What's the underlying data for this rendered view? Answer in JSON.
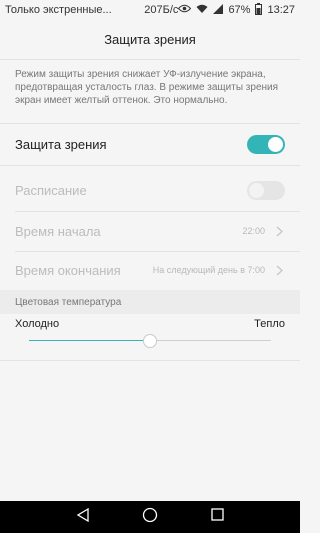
{
  "status_bar": {
    "carrier": "Только экстренные...",
    "net_speed": "207Б/с",
    "battery": "67%",
    "time": "13:27",
    "icons": [
      "eye-icon",
      "wifi-icon",
      "signal-icon",
      "battery-icon"
    ]
  },
  "header": {
    "title": "Защита зрения"
  },
  "description": "Режим защиты зрения снижает УФ-излучение экрана, предотвращая усталость глаз. В режиме защиты зрения экран имеет желтый оттенок. Это нормально.",
  "settings": {
    "eye_protection": {
      "label": "Защита зрения",
      "enabled": true
    },
    "schedule": {
      "label": "Расписание",
      "enabled": false
    },
    "start_time": {
      "label": "Время начала",
      "value": "22:00"
    },
    "end_time": {
      "label": "Время окончания",
      "value": "На следующий день в 7:00"
    }
  },
  "color_temperature": {
    "section_title": "Цветовая температура",
    "cold_label": "Холодно",
    "warm_label": "Тепло",
    "level": 0.5
  },
  "colors": {
    "accent": "#33b5b8"
  },
  "nav_bar": [
    "back-icon",
    "home-icon",
    "recents-icon"
  ]
}
